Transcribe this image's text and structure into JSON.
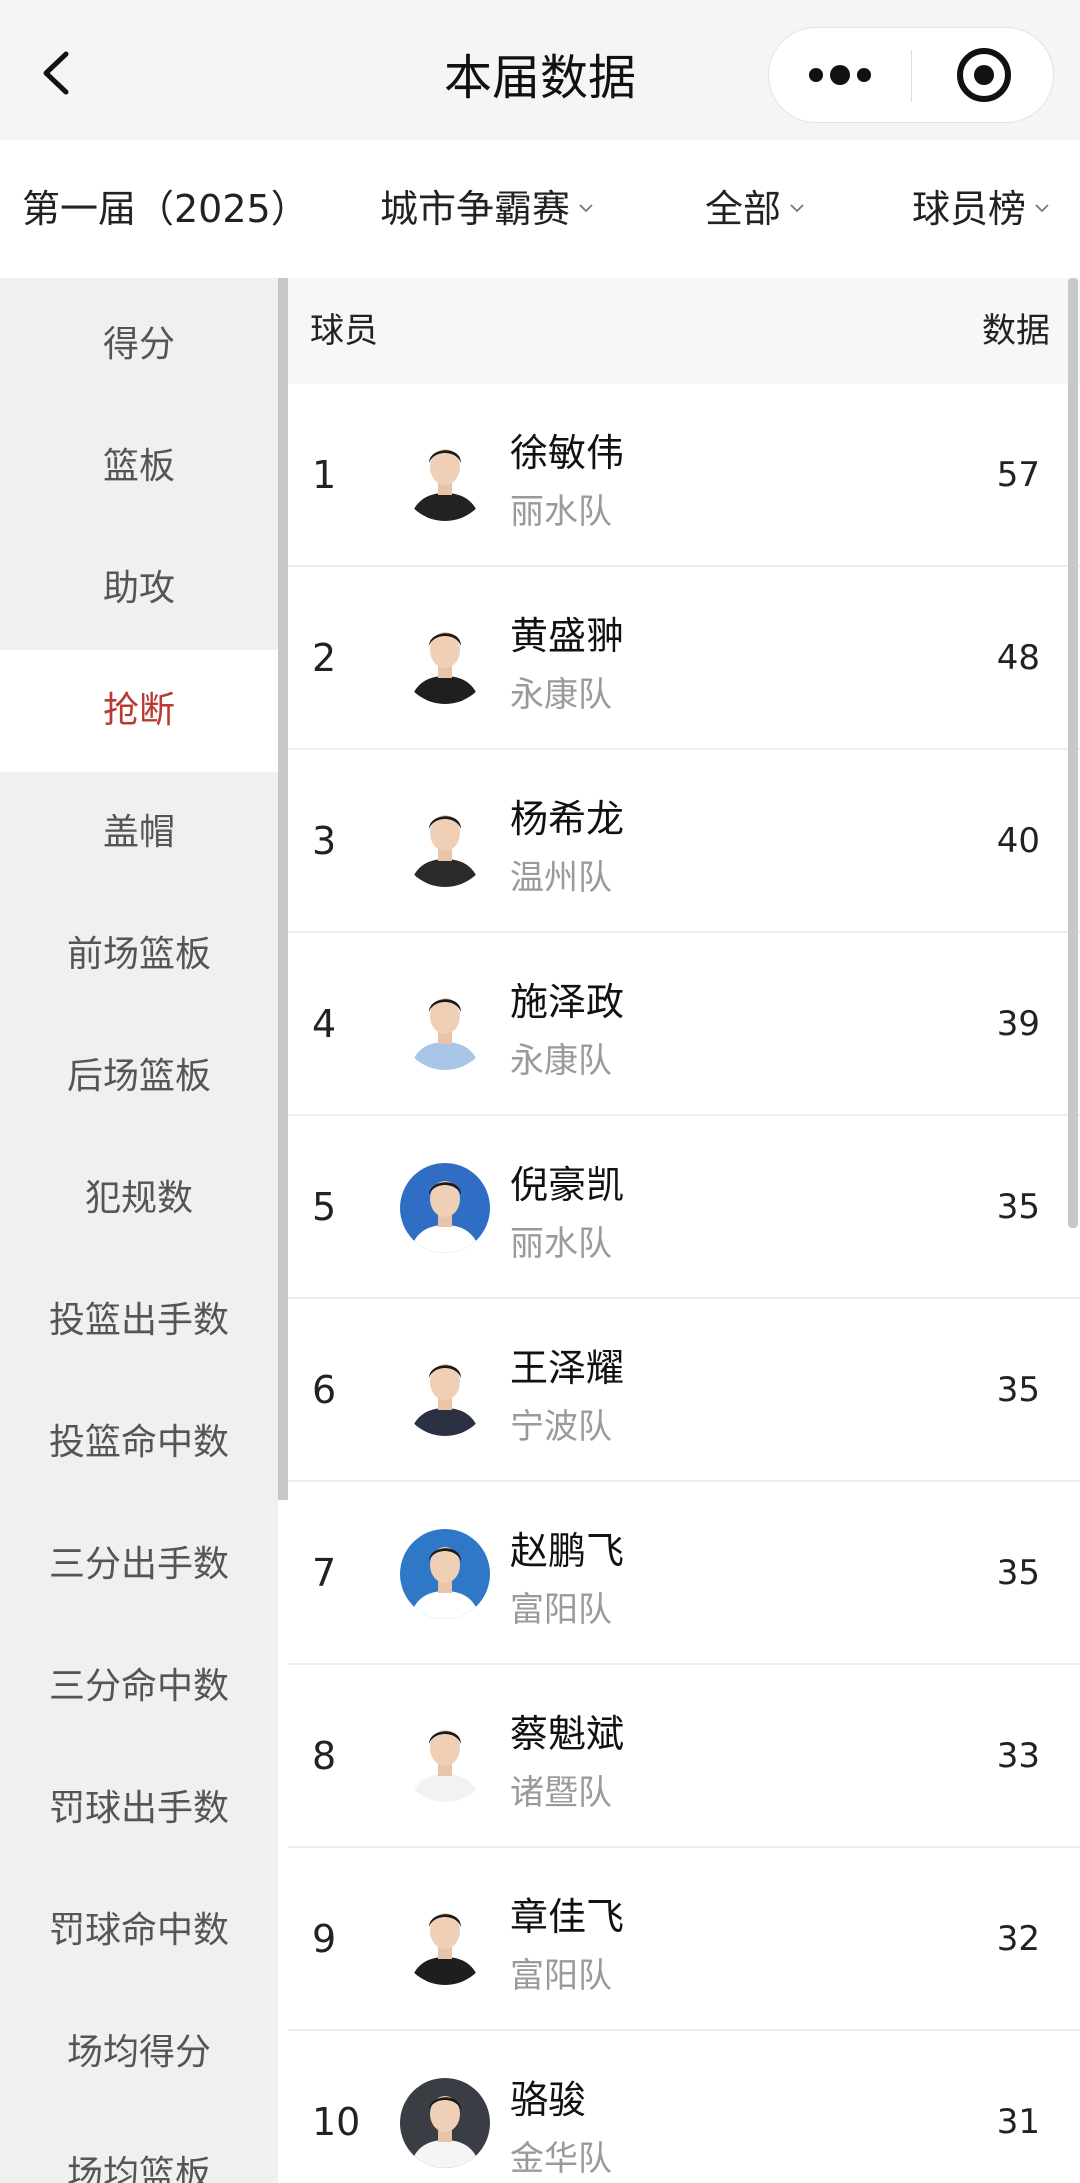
{
  "header": {
    "title": "本届数据"
  },
  "filters": {
    "season": "第一届（2025）",
    "competition": "城市争霸赛",
    "scope": "全部",
    "board": "球员榜"
  },
  "sidebar": {
    "items": [
      {
        "label": "得分"
      },
      {
        "label": "篮板"
      },
      {
        "label": "助攻"
      },
      {
        "label": "抢断",
        "active": true
      },
      {
        "label": "盖帽"
      },
      {
        "label": "前场篮板"
      },
      {
        "label": "后场篮板"
      },
      {
        "label": "犯规数"
      },
      {
        "label": "投篮出手数"
      },
      {
        "label": "投篮命中数"
      },
      {
        "label": "三分出手数"
      },
      {
        "label": "三分命中数"
      },
      {
        "label": "罚球出手数"
      },
      {
        "label": "罚球命中数"
      },
      {
        "label": "场均得分"
      },
      {
        "label": "场均篮板"
      }
    ],
    "active_color": "#b83a32"
  },
  "table": {
    "header_player": "球员",
    "header_data": "数据",
    "rows": [
      {
        "rank": "1",
        "name": "徐敏伟",
        "team": "丽水队",
        "value": "57",
        "avatar_bg": "#ffffff",
        "shirt": "#222222"
      },
      {
        "rank": "2",
        "name": "黄盛翀",
        "team": "永康队",
        "value": "48",
        "avatar_bg": "#ffffff",
        "shirt": "#1f1f1f"
      },
      {
        "rank": "3",
        "name": "杨希龙",
        "team": "温州队",
        "value": "40",
        "avatar_bg": "#ffffff",
        "shirt": "#2a2a2a"
      },
      {
        "rank": "4",
        "name": "施泽政",
        "team": "永康队",
        "value": "39",
        "avatar_bg": "#ffffff",
        "shirt": "#a9c6e8"
      },
      {
        "rank": "5",
        "name": "倪豪凯",
        "team": "丽水队",
        "value": "35",
        "avatar_bg": "#2f6ec4",
        "shirt": "#ffffff"
      },
      {
        "rank": "6",
        "name": "王泽耀",
        "team": "宁波队",
        "value": "35",
        "avatar_bg": "#ffffff",
        "shirt": "#2b3142"
      },
      {
        "rank": "7",
        "name": "赵鹏飞",
        "team": "富阳队",
        "value": "35",
        "avatar_bg": "#2f78c8",
        "shirt": "#ffffff"
      },
      {
        "rank": "8",
        "name": "蔡魁斌",
        "team": "诸暨队",
        "value": "33",
        "avatar_bg": "#ffffff",
        "shirt": "#f2f2f2"
      },
      {
        "rank": "9",
        "name": "章佳飞",
        "team": "富阳队",
        "value": "32",
        "avatar_bg": "#ffffff",
        "shirt": "#1e1e1e"
      },
      {
        "rank": "10",
        "name": "骆骏",
        "team": "金华队",
        "value": "31",
        "avatar_bg": "#3a3d44",
        "shirt": "#f5f5f5"
      }
    ]
  },
  "icons": {
    "back": "chevron-left-icon",
    "more": "more-dots-icon",
    "close": "target-close-icon",
    "dropdown": "chevron-down-icon"
  }
}
